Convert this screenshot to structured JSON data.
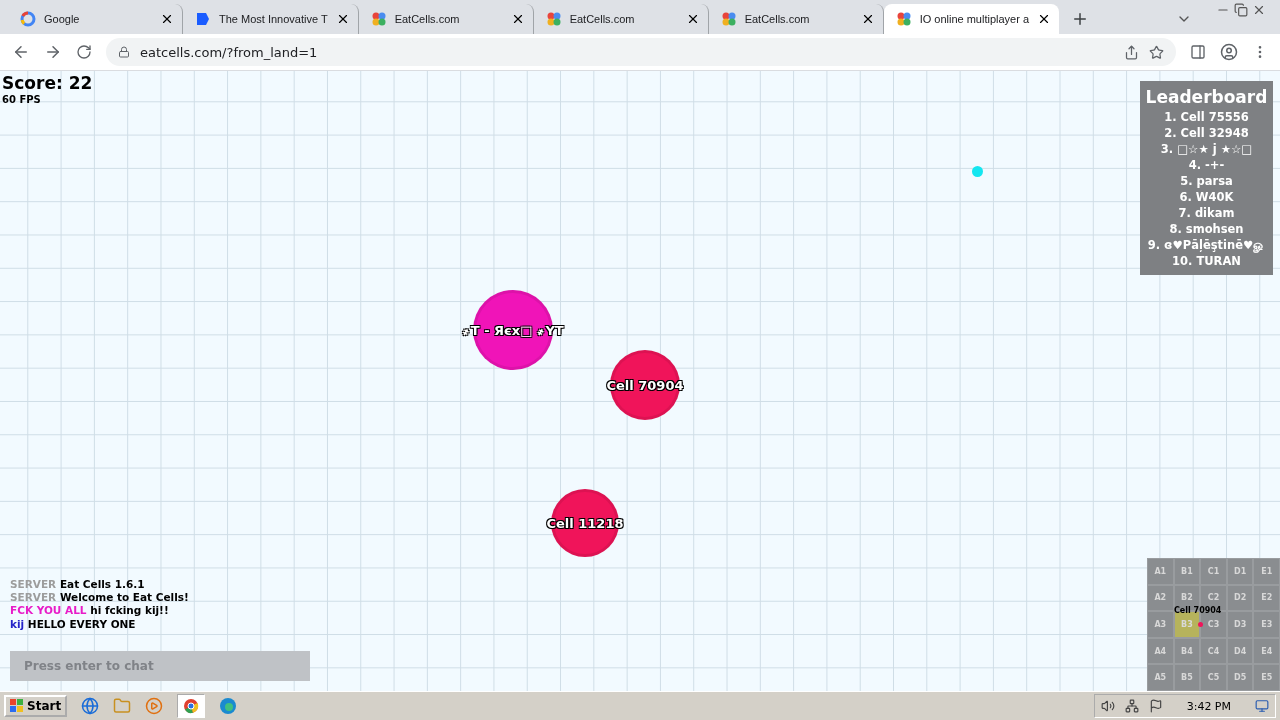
{
  "browser": {
    "tabs": [
      {
        "title": "Google",
        "kind": "google",
        "selected": false
      },
      {
        "title": "The Most Innovative T",
        "kind": "blue",
        "selected": false
      },
      {
        "title": "EatCells.com",
        "kind": "cells",
        "selected": false
      },
      {
        "title": "EatCells.com",
        "kind": "cells",
        "selected": false
      },
      {
        "title": "EatCells.com",
        "kind": "cells",
        "selected": false
      },
      {
        "title": "IO online multiplayer a",
        "kind": "cells",
        "selected": true
      }
    ],
    "address": "eatcells.com/?from_land=1"
  },
  "game": {
    "score": "Score: 22",
    "fps": "60 FPS",
    "cells": [
      {
        "name": "҂T - Яєx□ ҂YT",
        "color": "#f014b8"
      },
      {
        "name": "Cell 70904",
        "color": "#f0145a"
      },
      {
        "name": "Cell 11218",
        "color": "#f0145a"
      }
    ],
    "pellets": [
      {
        "color": "#14e6f0"
      }
    ],
    "leaderboard": {
      "title": "Leaderboard",
      "entries": [
        "1. Cell 75556",
        "2. Cell 32948",
        "3. □☆★ j ★☆□",
        "4. -+-",
        "5. parsa",
        "6. W40K",
        "7. dikam",
        "8. smohsen",
        "9. ɞ♥Pāļēştinē♥ௐ",
        "10. TURAN"
      ]
    },
    "chat": {
      "messages": [
        {
          "sender": "SERVER",
          "color": "#9c9c9c",
          "text": "Eat Cells 1.6.1"
        },
        {
          "sender": "SERVER",
          "color": "#9c9c9c",
          "text": "Welcome to Eat Cells!"
        },
        {
          "sender": "FCK YOU ALL",
          "color": "#e81cc8",
          "text": "hi fcking kij!!"
        },
        {
          "sender": "kij",
          "color": "#2424c8",
          "text": "HELLO EVERY ONE"
        }
      ],
      "placeholder": "Press enter to chat"
    },
    "minimap": {
      "player": "Cell 70904",
      "sectors": [
        {
          "label": "A1",
          "selected": false
        },
        {
          "label": "B1",
          "selected": false
        },
        {
          "label": "C1",
          "selected": false
        },
        {
          "label": "D1",
          "selected": false
        },
        {
          "label": "E1",
          "selected": false
        },
        {
          "label": "A2",
          "selected": false
        },
        {
          "label": "B2",
          "selected": false
        },
        {
          "label": "C2",
          "selected": false
        },
        {
          "label": "D2",
          "selected": false
        },
        {
          "label": "E2",
          "selected": false
        },
        {
          "label": "A3",
          "selected": false
        },
        {
          "label": "B3",
          "selected": true
        },
        {
          "label": "C3",
          "selected": false
        },
        {
          "label": "D3",
          "selected": false
        },
        {
          "label": "E3",
          "selected": false
        },
        {
          "label": "A4",
          "selected": false
        },
        {
          "label": "B4",
          "selected": false
        },
        {
          "label": "C4",
          "selected": false
        },
        {
          "label": "D4",
          "selected": false
        },
        {
          "label": "E4",
          "selected": false
        },
        {
          "label": "A5",
          "selected": false
        },
        {
          "label": "B5",
          "selected": false
        },
        {
          "label": "C5",
          "selected": false
        },
        {
          "label": "D5",
          "selected": false
        },
        {
          "label": "E5",
          "selected": false
        }
      ]
    }
  },
  "taskbar": {
    "start": "Start",
    "clock": "3:42 PM"
  }
}
